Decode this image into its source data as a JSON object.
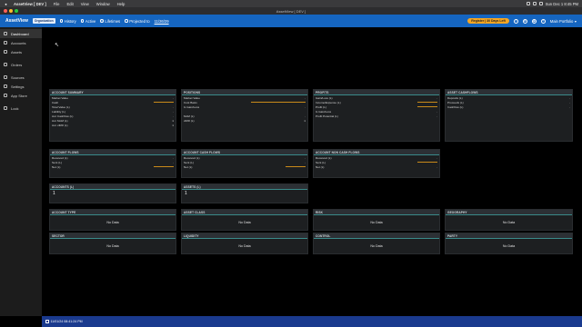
{
  "menubar": {
    "items": [
      "AssetView [ DEV ]",
      "File",
      "Edit",
      "View",
      "Window",
      "Help"
    ],
    "clock": "Sun Dec 1 8:45 PM"
  },
  "window": {
    "title": "AssetView [ DEV ]"
  },
  "header": {
    "logo": "AssetView",
    "org_badge": "Organization",
    "options": [
      "History",
      "Active",
      "Lifetimes",
      "Projected to"
    ],
    "projected_date": "11/26/29",
    "register_label": "Register | 30 Days Left",
    "portfolio_label": "Main Portfolio"
  },
  "sidebar": {
    "items": [
      {
        "label": "Dashboard",
        "icon": "dashboard-icon"
      },
      {
        "label": "Accounts",
        "icon": "accounts-icon"
      },
      {
        "label": "Assets",
        "icon": "assets-icon"
      },
      {
        "label": "Orders",
        "icon": "orders-icon"
      },
      {
        "label": "Sources",
        "icon": "sources-icon"
      },
      {
        "label": "Settings",
        "icon": "gear-icon"
      },
      {
        "label": "App Store",
        "icon": "app-store-icon"
      },
      {
        "label": "Lock",
        "icon": "lock-icon"
      }
    ]
  },
  "panels": {
    "account_summary": {
      "title": "ACCOUNT SUMMARY",
      "rows": [
        "Market Value",
        "Cash",
        "Total Value (L)",
        "Liability (L)",
        "Acc Cashflow (L)",
        "Acc MoM (L)",
        "Acc xIRR (L)"
      ],
      "values": [
        "-",
        "-",
        "-",
        "-",
        "-",
        "1",
        "1"
      ]
    },
    "positions": {
      "title": "POSITIONS",
      "rows": [
        "Market Value",
        "Cost Basis",
        "G Gain/Loss",
        "",
        "MoM (L)",
        "xIRR (L)"
      ],
      "values": [
        "-",
        "-",
        "-",
        "",
        "-",
        "1"
      ]
    },
    "profits": {
      "title": "PROFITS",
      "rows": [
        "Gain/Loss (L)",
        "Income/Expense (L)",
        "Profit (L)",
        "G Gain/Loss",
        "Profit Potential (L)"
      ],
      "values": [
        "-",
        "-",
        "-",
        "-",
        "-"
      ]
    },
    "asset_cashflows": {
      "title": "ASSET CASHFLOWS",
      "rows": [
        "Deposits (L)",
        "Proceeds (L)",
        "Cashflow (L)"
      ],
      "values": [
        "-",
        "-",
        "-"
      ]
    },
    "account_flows": {
      "title": "ACCOUNT FLOWS",
      "rows": [
        "Received (L)",
        "Sent (L)",
        "Net (L)"
      ],
      "values": [
        "-",
        "-",
        "-"
      ]
    },
    "account_cash_flows": {
      "title": "ACCOUNT CASH FLOWS",
      "rows": [
        "Received (L)",
        "Sent (L)",
        "Net (L)"
      ],
      "values": [
        "-",
        "-",
        "-"
      ]
    },
    "account_non_cash_flows": {
      "title": "ACCOUNT NON CASH FLOWS",
      "rows": [
        "Received (L)",
        "Sent (L)",
        "Net (L)"
      ],
      "values": [
        "-",
        "-",
        "-"
      ]
    },
    "accounts_count": {
      "title": "ACCOUNTS (L)",
      "value": "1"
    },
    "assets_count": {
      "title": "ASSETS (L)",
      "value": "1"
    },
    "nodata_label": "No Data",
    "breakdowns": [
      "ACCOUNT TYPE",
      "ASSET CLASS",
      "RISK",
      "GEOGRAPHY",
      "SECTOR",
      "LIQUIDITY",
      "CONTROL",
      "PARTY"
    ]
  },
  "footer": {
    "timestamp": "11/01/24 08:41:24 PM"
  },
  "colors": {
    "brand": "#1565c0",
    "accent": "#f5a623",
    "footer": "#1a3a8e",
    "spark": "#c98a1a"
  }
}
